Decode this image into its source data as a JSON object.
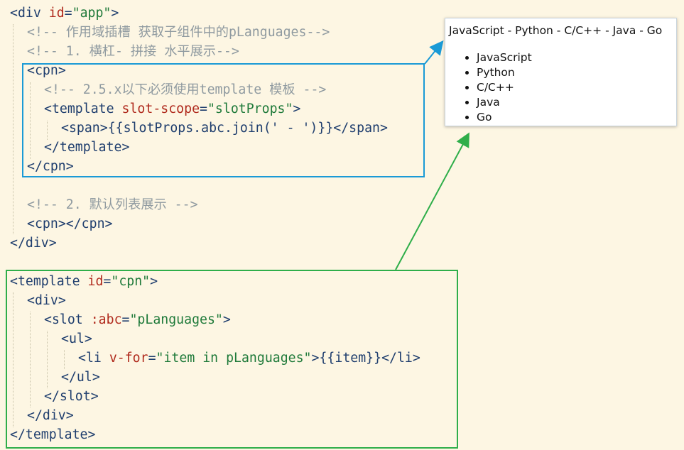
{
  "code": {
    "app_block": {
      "open_tag": "div",
      "id_attr": "id",
      "id_value": "\"app\"",
      "comment_scoped_slot": "<!-- 作用域插槽 获取子组件中的pLanguages-->",
      "comment_join": "<!-- 1. 横杠- 拼接 水平展示-->",
      "cpn_tag": "cpn",
      "comment_version": "<!-- 2.5.x以下必须使用template 模板 -->",
      "template_tag": "template",
      "slot_scope_attr": "slot-scope",
      "slot_scope_value": "\"slotProps\"",
      "span_tag": "span",
      "span_content": "{{slotProps.abc.join(' - ')}}",
      "comment_list": "<!-- 2. 默认列表展示 -->"
    },
    "template_block": {
      "template_tag": "template",
      "id_attr": "id",
      "id_value": "\"cpn\"",
      "div_tag": "div",
      "slot_tag": "slot",
      "slot_attr": ":abc",
      "slot_value": "\"pLanguages\"",
      "ul_tag": "ul",
      "li_tag": "li",
      "vfor_attr": "v-for",
      "vfor_value": "\"item in pLanguages\"",
      "li_content": "{{item}}"
    }
  },
  "preview": {
    "joined": "JavaScript - Python - C/C++ - Java - Go",
    "items": [
      "JavaScript",
      "Python",
      "C/C++",
      "Java",
      "Go"
    ]
  },
  "colors": {
    "background": "#fdf6e3",
    "blue_box": "#1a9ad6",
    "green_box": "#2fae4a"
  }
}
